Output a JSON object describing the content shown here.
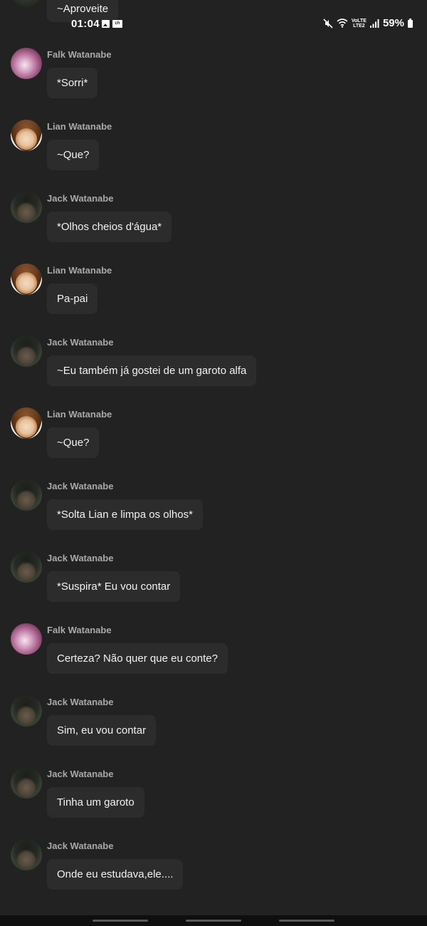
{
  "status_bar": {
    "time": "01:04",
    "battery_percent": "59%",
    "network_label_top": "VoLTE",
    "network_label_bottom": "LTE2",
    "left_icons": [
      "gallery-icon",
      "channel-icon"
    ],
    "right_icons": [
      "mute-icon",
      "wifi-icon",
      "signal-icon",
      "battery-icon"
    ]
  },
  "top_partial_message": {
    "text": "~Aproveite"
  },
  "messages": [
    {
      "sender": "Falk Watanabe",
      "avatar": "falk",
      "text": "*Sorri*"
    },
    {
      "sender": "Lian Watanabe",
      "avatar": "lian",
      "text": "~Que?"
    },
    {
      "sender": "Jack Watanabe",
      "avatar": "jack",
      "text": "*Olhos cheios d'água*"
    },
    {
      "sender": "Lian Watanabe",
      "avatar": "lian",
      "text": "Pa-pai"
    },
    {
      "sender": "Jack Watanabe",
      "avatar": "jack",
      "text": "~Eu também já gostei de um garoto alfa"
    },
    {
      "sender": "Lian Watanabe",
      "avatar": "lian",
      "text": "~Que?"
    },
    {
      "sender": "Jack Watanabe",
      "avatar": "jack",
      "text": "*Solta Lian e limpa os olhos*"
    },
    {
      "sender": "Jack Watanabe",
      "avatar": "jack",
      "text": "*Suspira* Eu vou contar"
    },
    {
      "sender": "Falk Watanabe",
      "avatar": "falk",
      "text": "Certeza? Não quer que eu conte?"
    },
    {
      "sender": "Jack Watanabe",
      "avatar": "jack",
      "text": "Sim, eu vou contar"
    },
    {
      "sender": "Jack Watanabe",
      "avatar": "jack",
      "text": "Tinha um garoto"
    },
    {
      "sender": "Jack Watanabe",
      "avatar": "jack",
      "text": "Onde eu estudava,ele...."
    }
  ],
  "colors": {
    "background": "#222222",
    "bubble": "#2c2c2c",
    "sender_name": "#a9a9a9",
    "message_text": "#f2f2f2"
  }
}
